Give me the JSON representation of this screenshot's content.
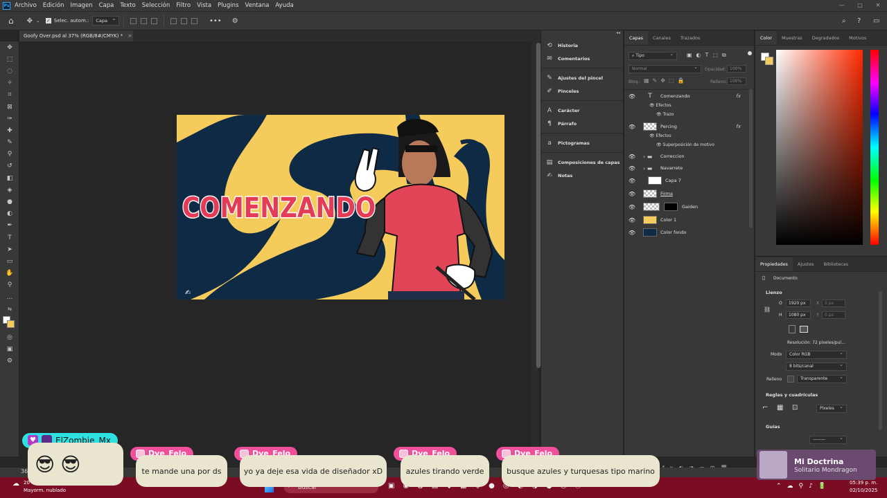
{
  "menu": {
    "app_icon": "Ps",
    "items": [
      "Archivo",
      "Edición",
      "Imagen",
      "Capa",
      "Texto",
      "Selección",
      "Filtro",
      "Vista",
      "Plugins",
      "Ventana",
      "Ayuda"
    ]
  },
  "options": {
    "auto_select_label": "Selec. autom.:",
    "auto_select_value": "Capa"
  },
  "document": {
    "tab_title": "Goofy Over.psd al 37% (RGB/8#/CMYK) *",
    "close": "×"
  },
  "artwork": {
    "title_text": "COMENZANDO",
    "colors": {
      "bg": "#f5cb5c",
      "navy": "#0f2a44",
      "red": "#e43b56"
    }
  },
  "collapsed_panels": [
    {
      "icon": "history-icon",
      "glyph": "⟲",
      "label": "Historia"
    },
    {
      "icon": "comments-icon",
      "glyph": "✉",
      "label": "Comentarios"
    },
    {
      "icon": "brush-settings-icon",
      "glyph": "✎",
      "label": "Ajustes del pincel"
    },
    {
      "icon": "brushes-icon",
      "glyph": "✐",
      "label": "Pinceles"
    },
    {
      "icon": "character-icon",
      "glyph": "A",
      "label": "Carácter"
    },
    {
      "icon": "paragraph-icon",
      "glyph": "¶",
      "label": "Párrafo"
    },
    {
      "icon": "glyphs-icon",
      "glyph": "a",
      "label": "Pictogramas"
    },
    {
      "icon": "layer-comps-icon",
      "glyph": "▤",
      "label": "Composiciones de capas"
    },
    {
      "icon": "notes-icon",
      "glyph": "✍",
      "label": "Notas"
    }
  ],
  "layers_panel": {
    "tabs": [
      "Capas",
      "Canales",
      "Trazados"
    ],
    "filter_label": "Tipo",
    "blend_mode": "Normal",
    "opacity_label": "Opacidad:",
    "opacity_value": "100%",
    "lock_label": "Bloq.:",
    "fill_label": "Relleno:",
    "fill_value": "100%",
    "fx": "fx",
    "layers": [
      {
        "name": "Comenzando",
        "kind": "text",
        "fx": true
      },
      {
        "name": "Efectos",
        "kind": "sub"
      },
      {
        "name": "Trazo",
        "kind": "sub2"
      },
      {
        "name": "Percing",
        "kind": "raster",
        "fx": true
      },
      {
        "name": "Efectos",
        "kind": "sub"
      },
      {
        "name": "Superposición de motivo",
        "kind": "sub2"
      },
      {
        "name": "Correccion",
        "kind": "group"
      },
      {
        "name": "Navarrete",
        "kind": "group"
      },
      {
        "name": "Capa 7",
        "kind": "white"
      },
      {
        "name": "Firma",
        "kind": "raster"
      },
      {
        "name": "Gaiden",
        "kind": "masked"
      },
      {
        "name": "Color 1",
        "kind": "yellow"
      },
      {
        "name": "Color fondo",
        "kind": "navy"
      }
    ]
  },
  "color_panel": {
    "tabs": [
      "Color",
      "Muestras",
      "Degradados",
      "Motivos"
    ]
  },
  "properties_panel": {
    "tabs": [
      "Propiedades",
      "Ajustes",
      "Bibliotecas"
    ],
    "document_label": "Documento",
    "canvas_section": "Lienzo",
    "w_label": "O",
    "w_value": "1920 px",
    "h_label": "H",
    "h_value": "1080 px",
    "x_label": "X",
    "x_placeholder": "0 px",
    "y_label": "Y",
    "y_placeholder": "0 px",
    "resolution": "Resolución: 72 píxeles/pul...",
    "mode_label": "Modo",
    "mode_value": "Color RGB",
    "depth_value": "8 bits/canal",
    "fill_label": "Relleno",
    "fill_value": "Transparente",
    "rulers_section": "Reglas y cuadrículas",
    "units_value": "Píxeles",
    "guides_section": "Guías"
  },
  "chat": {
    "first_user": "ElZombie_Mx",
    "messages": [
      {
        "user": "Dye_Felo",
        "text": "te mande una por ds"
      },
      {
        "user": "Dye_Felo",
        "text": "yo ya deje esa vida de diseñador xD"
      },
      {
        "user": "Dye_Felo",
        "text": "azules tirando verde"
      },
      {
        "user": "Dye_Felo",
        "text": "busque azules y turquesas tipo marino"
      }
    ]
  },
  "music": {
    "title": "Mi Doctrina",
    "artist": "Solitario Mondragon"
  },
  "taskbar": {
    "weather_temp": "20",
    "weather_desc": "Mayorm. nublado",
    "search_placeholder": "Buscar",
    "time": "05:39 p. m.",
    "date": "02/10/2025",
    "zoom": "36"
  }
}
